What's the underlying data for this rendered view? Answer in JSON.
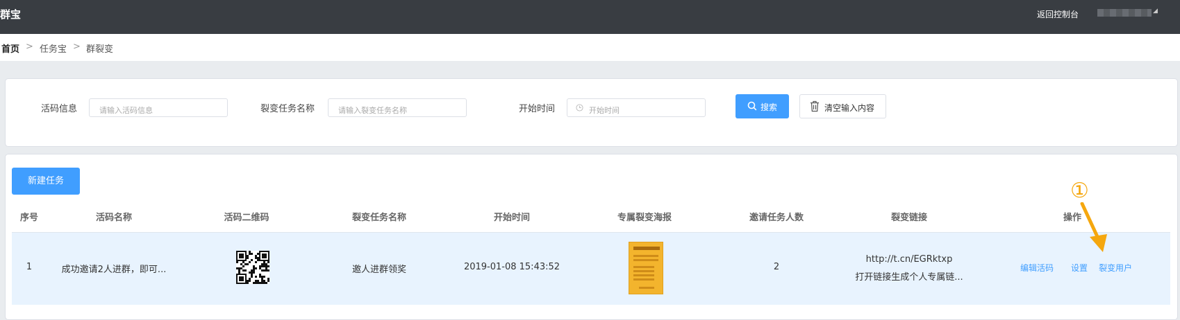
{
  "topbar": {
    "brand": "群宝",
    "back_label": "返回控制台"
  },
  "breadcrumb": {
    "home": "首页",
    "sep": ">",
    "items": [
      "任务宝",
      "群裂变"
    ]
  },
  "search": {
    "field1_label": "活码信息",
    "field1_placeholder": "请输入活码信息",
    "field2_label": "裂变任务名称",
    "field2_placeholder": "请输入裂变任务名称",
    "field3_label": "开始时间",
    "field3_placeholder": "开始时间",
    "search_button": "搜索",
    "clear_button": "清空输入内容"
  },
  "list": {
    "new_button": "新建任务",
    "columns": [
      "序号",
      "活码名称",
      "活码二维码",
      "裂变任务名称",
      "开始时间",
      "专属裂变海报",
      "邀请任务人数",
      "裂变链接",
      "操作"
    ],
    "rows": [
      {
        "index": "1",
        "code_name": "成功邀请2人进群，即可...",
        "task_name": "邀人进群领奖",
        "start_time": "2019-01-08 15:43:52",
        "invite_count": "2",
        "link_url": "http://t.cn/EGRktxp",
        "link_desc": "打开链接生成个人专属链...",
        "actions": [
          "编辑活码",
          "设置",
          "裂变用户"
        ]
      }
    ]
  },
  "annotation": {
    "marker": "①",
    "color": "#f5a70e"
  },
  "colors": {
    "primary": "#409eff",
    "topbar": "#393d42",
    "row_highlight": "#e8f3fe"
  }
}
